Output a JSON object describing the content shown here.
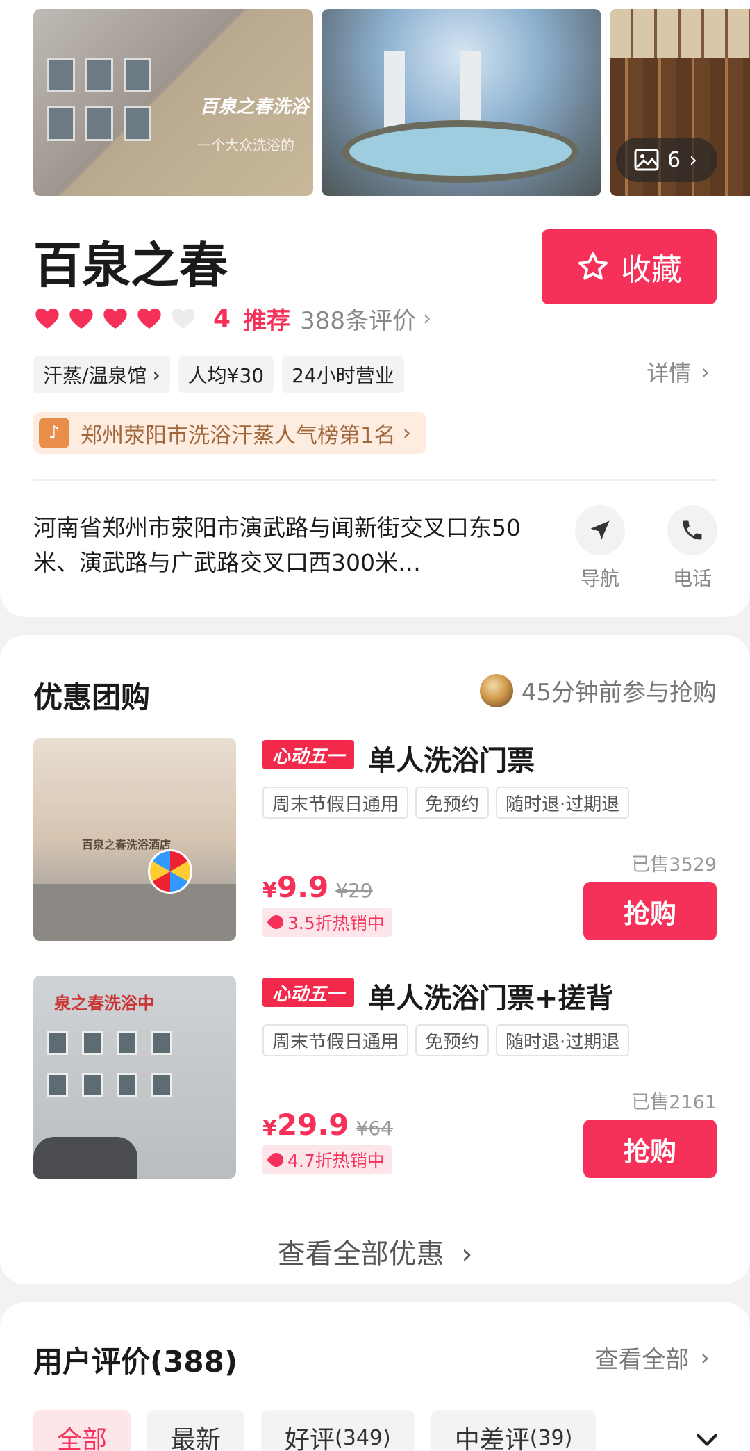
{
  "gallery": {
    "photo1_banner": "百泉之春洗浴",
    "photo1_sub": "一个大众洗浴的",
    "photo_count": "6"
  },
  "shop": {
    "name": "百泉之春",
    "fav_label": "收藏",
    "score": "4",
    "recommend": "推荐",
    "reviews_count": "388条评价",
    "hearts_filled": 4,
    "hearts_total": 5
  },
  "tags": [
    "汗蒸/温泉馆",
    "人均¥30",
    "24小时营业"
  ],
  "detail_label": "详情",
  "rank": "郑州荥阳市洗浴汗蒸人气榜第1名",
  "address": "河南省郑州市荥阳市演武路与闻新街交叉口东50米、演武路与广武路交叉口西300米…",
  "actions": {
    "nav": "导航",
    "phone": "电话"
  },
  "deals_section": {
    "title": "优惠团购",
    "recent": "45分钟前参与抢购",
    "see_all": "查看全部优惠",
    "items": [
      {
        "badge": "心动五一",
        "title": "单人洗浴门票",
        "tags": [
          "周末节假日通用",
          "免预约",
          "随时退·过期退"
        ],
        "sold": "已售3529",
        "currency": "¥",
        "price": "9.9",
        "orig": "¥29",
        "discount": "3.5折热销中",
        "buy": "抢购",
        "img_sign": "百泉之春洗浴酒店"
      },
      {
        "badge": "心动五一",
        "title": "单人洗浴门票+搓背",
        "tags": [
          "周末节假日通用",
          "免预约",
          "随时退·过期退"
        ],
        "sold": "已售2161",
        "currency": "¥",
        "price": "29.9",
        "orig": "¥64",
        "discount": "4.7折热销中",
        "buy": "抢购",
        "img_sign": "泉之春洗浴中"
      }
    ]
  },
  "reviews_section": {
    "title": "用户评价(388)",
    "view_all": "查看全部",
    "filters": [
      {
        "label": "全部",
        "count": ""
      },
      {
        "label": "最新",
        "count": ""
      },
      {
        "label": "好评",
        "count": "(349)"
      },
      {
        "label": "中差评",
        "count": "(39)"
      }
    ]
  },
  "colors": {
    "accent": "#f5315a",
    "rank_text": "#a0663c",
    "rank_bg": "#fdecdf"
  }
}
